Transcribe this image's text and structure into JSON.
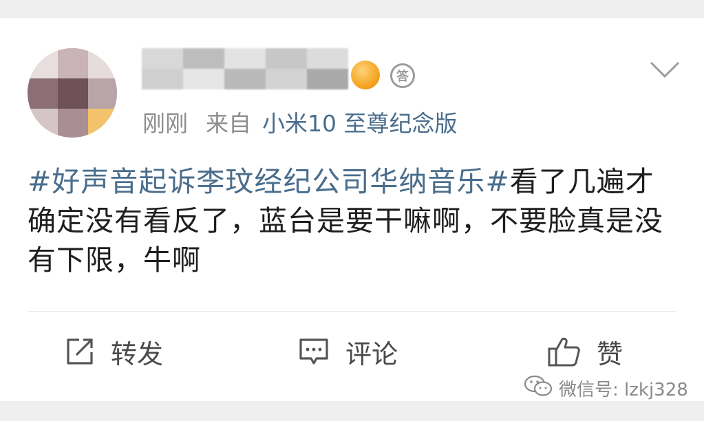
{
  "post": {
    "time": "刚刚",
    "source_prefix": "来自",
    "device": "小米10 至尊纪念版",
    "badge_text": "答",
    "topic": "#好声音起诉李玟经纪公司华纳音乐#",
    "body": "看了几遍才确定没有看反了，蓝台是要干嘛啊，不要脸真是没有下限，牛啊"
  },
  "actions": {
    "repost_label": "转发",
    "comment_label": "评论",
    "like_label": "赞"
  },
  "watermark": {
    "text": "微信号: lzkj328"
  },
  "icons": {
    "repost": "repost-icon",
    "comment": "comment-icon",
    "like": "thumbs-up-icon",
    "more": "chevron-down-icon",
    "wechat": "wechat-icon"
  },
  "colors": {
    "link": "#4a6d8c",
    "meta": "#8d8d8d",
    "text": "#1e1e1e",
    "background": "#efefef"
  }
}
